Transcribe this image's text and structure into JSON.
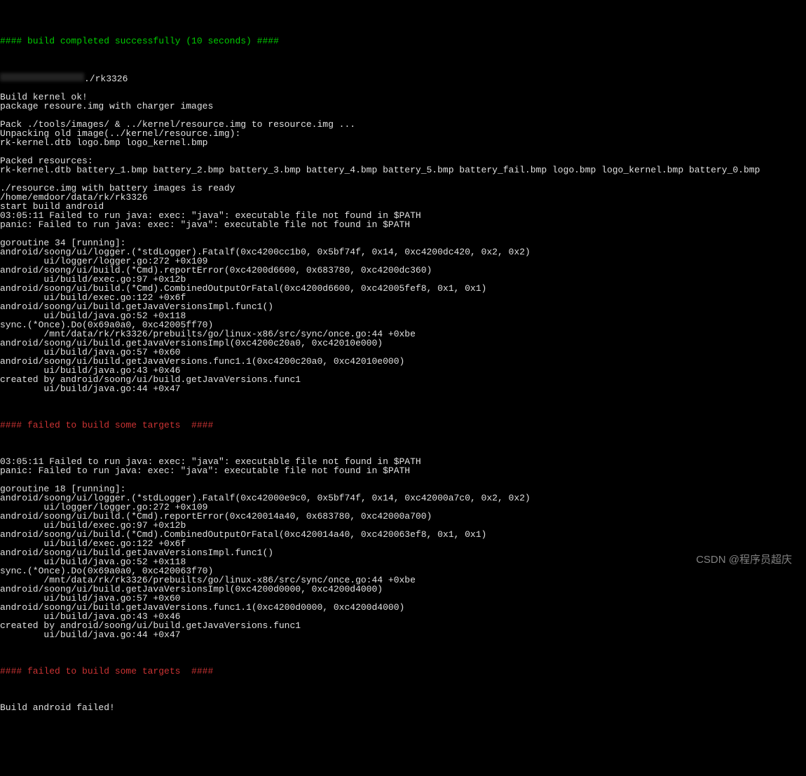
{
  "terminal": {
    "build_success": "#### build completed successfully (10 seconds) ####",
    "blurred_path_suffix": "./rk3326",
    "lines_1": "Build kernel ok!\npackage resoure.img with charger images\n\nPack ./tools/images/ & ../kernel/resource.img to resource.img ...\nUnpacking old image(../kernel/resource.img):\nrk-kernel.dtb logo.bmp logo_kernel.bmp\n\nPacked resources:\nrk-kernel.dtb battery_1.bmp battery_2.bmp battery_3.bmp battery_4.bmp battery_5.bmp battery_fail.bmp logo.bmp logo_kernel.bmp battery_0.bmp\n\n./resource.img with battery images is ready\n/home/emdoor/data/rk/rk3326\nstart build android\n03:05:11 Failed to run java: exec: \"java\": executable file not found in $PATH\npanic: Failed to run java: exec: \"java\": executable file not found in $PATH\n\ngoroutine 34 [running]:\nandroid/soong/ui/logger.(*stdLogger).Fatalf(0xc4200cc1b0, 0x5bf74f, 0x14, 0xc4200dc420, 0x2, 0x2)\n        ui/logger/logger.go:272 +0x109\nandroid/soong/ui/build.(*Cmd).reportError(0xc4200d6600, 0x683780, 0xc4200dc360)\n        ui/build/exec.go:97 +0x12b\nandroid/soong/ui/build.(*Cmd).CombinedOutputOrFatal(0xc4200d6600, 0xc42005fef8, 0x1, 0x1)\n        ui/build/exec.go:122 +0x6f\nandroid/soong/ui/build.getJavaVersionsImpl.func1()\n        ui/build/java.go:52 +0x118\nsync.(*Once).Do(0x69a0a0, 0xc42005ff70)\n        /mnt/data/rk/rk3326/prebuilts/go/linux-x86/src/sync/once.go:44 +0xbe\nandroid/soong/ui/build.getJavaVersionsImpl(0xc4200c20a0, 0xc42010e000)\n        ui/build/java.go:57 +0x60\nandroid/soong/ui/build.getJavaVersions.func1.1(0xc4200c20a0, 0xc42010e000)\n        ui/build/java.go:43 +0x46\ncreated by android/soong/ui/build.getJavaVersions.func1\n        ui/build/java.go:44 +0x47",
    "fail_1": "#### failed to build some targets  ####",
    "lines_2": "03:05:11 Failed to run java: exec: \"java\": executable file not found in $PATH\npanic: Failed to run java: exec: \"java\": executable file not found in $PATH\n\ngoroutine 18 [running]:\nandroid/soong/ui/logger.(*stdLogger).Fatalf(0xc42000e9c0, 0x5bf74f, 0x14, 0xc42000a7c0, 0x2, 0x2)\n        ui/logger/logger.go:272 +0x109\nandroid/soong/ui/build.(*Cmd).reportError(0xc420014a40, 0x683780, 0xc42000a700)\n        ui/build/exec.go:97 +0x12b\nandroid/soong/ui/build.(*Cmd).CombinedOutputOrFatal(0xc420014a40, 0xc420063ef8, 0x1, 0x1)\n        ui/build/exec.go:122 +0x6f\nandroid/soong/ui/build.getJavaVersionsImpl.func1()\n        ui/build/java.go:52 +0x118\nsync.(*Once).Do(0x69a0a0, 0xc420063f70)\n        /mnt/data/rk/rk3326/prebuilts/go/linux-x86/src/sync/once.go:44 +0xbe\nandroid/soong/ui/build.getJavaVersionsImpl(0xc4200d0000, 0xc4200d4000)\n        ui/build/java.go:57 +0x60\nandroid/soong/ui/build.getJavaVersions.func1.1(0xc4200d0000, 0xc4200d4000)\n        ui/build/java.go:43 +0x46\ncreated by android/soong/ui/build.getJavaVersions.func1\n        ui/build/java.go:44 +0x47",
    "fail_2": "#### failed to build some targets  ####",
    "lines_3": "Build android failed!"
  },
  "watermark": "CSDN @程序员超庆"
}
